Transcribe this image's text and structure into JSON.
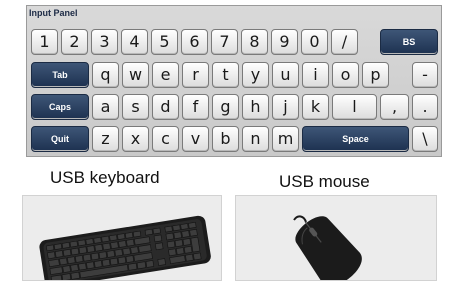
{
  "panel": {
    "title": "Input Panel"
  },
  "keys": {
    "row1": [
      "1",
      "2",
      "3",
      "4",
      "5",
      "6",
      "7",
      "8",
      "9",
      "0",
      "/"
    ],
    "backspace": "BS",
    "tab": "Tab",
    "row2": [
      "q",
      "w",
      "e",
      "r",
      "t",
      "y",
      "u",
      "i",
      "o",
      "p",
      "-"
    ],
    "caps": "Caps",
    "row3": [
      "a",
      "s",
      "d",
      "f",
      "g",
      "h",
      "j",
      "k",
      "l",
      ",",
      "."
    ],
    "quit": "Quit",
    "row4": [
      "z",
      "x",
      "c",
      "v",
      "b",
      "n",
      "m"
    ],
    "space": "Space",
    "backslash": "\\"
  },
  "captions": {
    "keyboard": "USB keyboard",
    "mouse": "USB mouse"
  },
  "colors": {
    "dark_key": "#23395a",
    "panel_bg": "#d0d0d0"
  }
}
